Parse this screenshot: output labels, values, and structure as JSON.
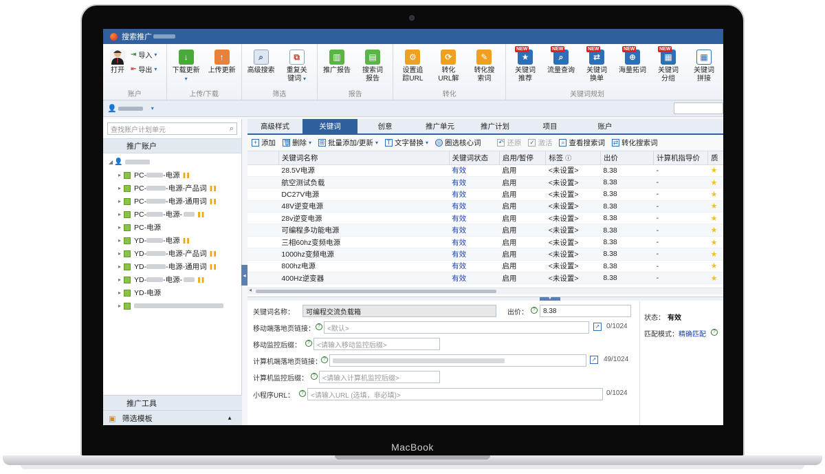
{
  "device": {
    "brand": "MacBook"
  },
  "window": {
    "title": "搜索推广"
  },
  "ribbon": {
    "account_group": {
      "label": "账户",
      "open": "打开",
      "import": "导入",
      "export": "导出"
    },
    "upload_group": {
      "label": "上传/下载",
      "download": "下载更新",
      "upload": "上传更新"
    },
    "filter_group": {
      "label": "筛选",
      "advanced_search": "高级搜索",
      "duplicate_keyword_1": "重复关",
      "duplicate_keyword_2": "键词"
    },
    "report_group": {
      "label": "报告",
      "promotion_report": "推广报告",
      "search_term_1": "搜索词",
      "search_term_2": "报告"
    },
    "convert_group": {
      "label": "转化",
      "track_url_1": "设置追",
      "track_url_2": "踪URL",
      "url_decode_1": "转化",
      "url_decode_2": "URL解",
      "convert_search_1": "转化搜",
      "convert_search_2": "索词"
    },
    "keyword_group": {
      "label": "关键词规划",
      "badge": "NEW",
      "recommend_1": "关键词",
      "recommend_2": "推荐",
      "traffic": "流量查询",
      "replace_1": "关键词",
      "replace_2": "换单",
      "mass": "海量拓词",
      "group_1": "关键词",
      "group_2": "分组",
      "merge_1": "关键词",
      "merge_2": "拼接"
    }
  },
  "left_panel": {
    "search_placeholder": "查找账户计划单元",
    "header": "推广账户",
    "tree": [
      {
        "prefix": "PC-",
        "suffix": "-电源",
        "paused": true
      },
      {
        "prefix": "PC-",
        "suffix": "-电源-产品词",
        "paused": true
      },
      {
        "prefix": "PC-",
        "suffix": "-电源-通用词",
        "paused": true
      },
      {
        "prefix": "PC-",
        "suffix": "-电源-",
        "paused": true
      },
      {
        "prefix": "PC-电源",
        "suffix": "",
        "paused": false
      },
      {
        "prefix": "YD-",
        "suffix": "-电源",
        "paused": true
      },
      {
        "prefix": "YD-",
        "suffix": "-电源-产品词",
        "paused": true
      },
      {
        "prefix": "YD-",
        "suffix": "-电源-通用词",
        "paused": true
      },
      {
        "prefix": "YD-",
        "suffix": "-电源-",
        "paused": true
      },
      {
        "prefix": "YD-电源",
        "suffix": "",
        "paused": false
      }
    ],
    "tools": "推广工具",
    "filter_template": "筛选模板"
  },
  "tabs": [
    "高级样式",
    "关键词",
    "创意",
    "推广单元",
    "推广计划",
    "项目",
    "账户"
  ],
  "toolbar": {
    "add": "添加",
    "delete": "删除",
    "batch": "批量添加/更新",
    "replace": "文字替换",
    "core": "圈选核心词",
    "restore": "还原",
    "activate": "激活",
    "view_search": "查看搜索词",
    "convert_search": "转化搜索词"
  },
  "table": {
    "columns": [
      "关键词名称",
      "关键词状态",
      "启用/暂停",
      "标签",
      "出价",
      "计算机指导价",
      "质"
    ],
    "rows": [
      [
        "28.5V电源",
        "有效",
        "启用",
        "<未设置>",
        "8.38",
        "-"
      ],
      [
        "航空测试负载",
        "有效",
        "启用",
        "<未设置>",
        "8.38",
        "-"
      ],
      [
        "DC27V电源",
        "有效",
        "启用",
        "<未设置>",
        "8.38",
        "-"
      ],
      [
        "48V逆变电源",
        "有效",
        "启用",
        "<未设置>",
        "8.38",
        "-"
      ],
      [
        "28v逆变电源",
        "有效",
        "启用",
        "<未设置>",
        "8.38",
        "-"
      ],
      [
        "可编程多功能电源",
        "有效",
        "启用",
        "<未设置>",
        "8.38",
        "-"
      ],
      [
        "三相60hz变频电源",
        "有效",
        "启用",
        "<未设置>",
        "8.38",
        "-"
      ],
      [
        "1000hz变频电源",
        "有效",
        "启用",
        "<未设置>",
        "8.38",
        "-"
      ],
      [
        "800hz电源",
        "有效",
        "启用",
        "<未设置>",
        "8.38",
        "-"
      ],
      [
        "400Hz逆变器",
        "有效",
        "启用",
        "<未设置>",
        "8.38",
        "-"
      ]
    ]
  },
  "detail": {
    "name_label": "关键词名称：",
    "name_value": "可编程交流负载箱",
    "bid_label": "出价：",
    "bid_value": "8.38",
    "mobile_url_label": "移动端落地页链接：",
    "mobile_url_placeholder": "<默认>",
    "mobile_url_count": "0/1024",
    "mobile_suffix_label": "移动监控后缀：",
    "mobile_suffix_placeholder": "<请输入移动监控后缀>",
    "pc_url_label": "计算机端落地页链接：",
    "pc_url_count": "49/1024",
    "pc_suffix_label": "计算机监控后缀：",
    "pc_suffix_placeholder": "<请输入计算机监控后缀>",
    "mini_label": "小程序URL：",
    "mini_placeholder": "<请输入URL (选填，非必填)>",
    "mini_count": "0/1024",
    "status_label": "状态：",
    "status_value": "有效",
    "match_label": "匹配模式：",
    "match_value": "精确匹配"
  },
  "colors": {
    "accent": "#2f5f9c",
    "valid": "#1a3fb0",
    "new_badge": "#e0221c"
  }
}
